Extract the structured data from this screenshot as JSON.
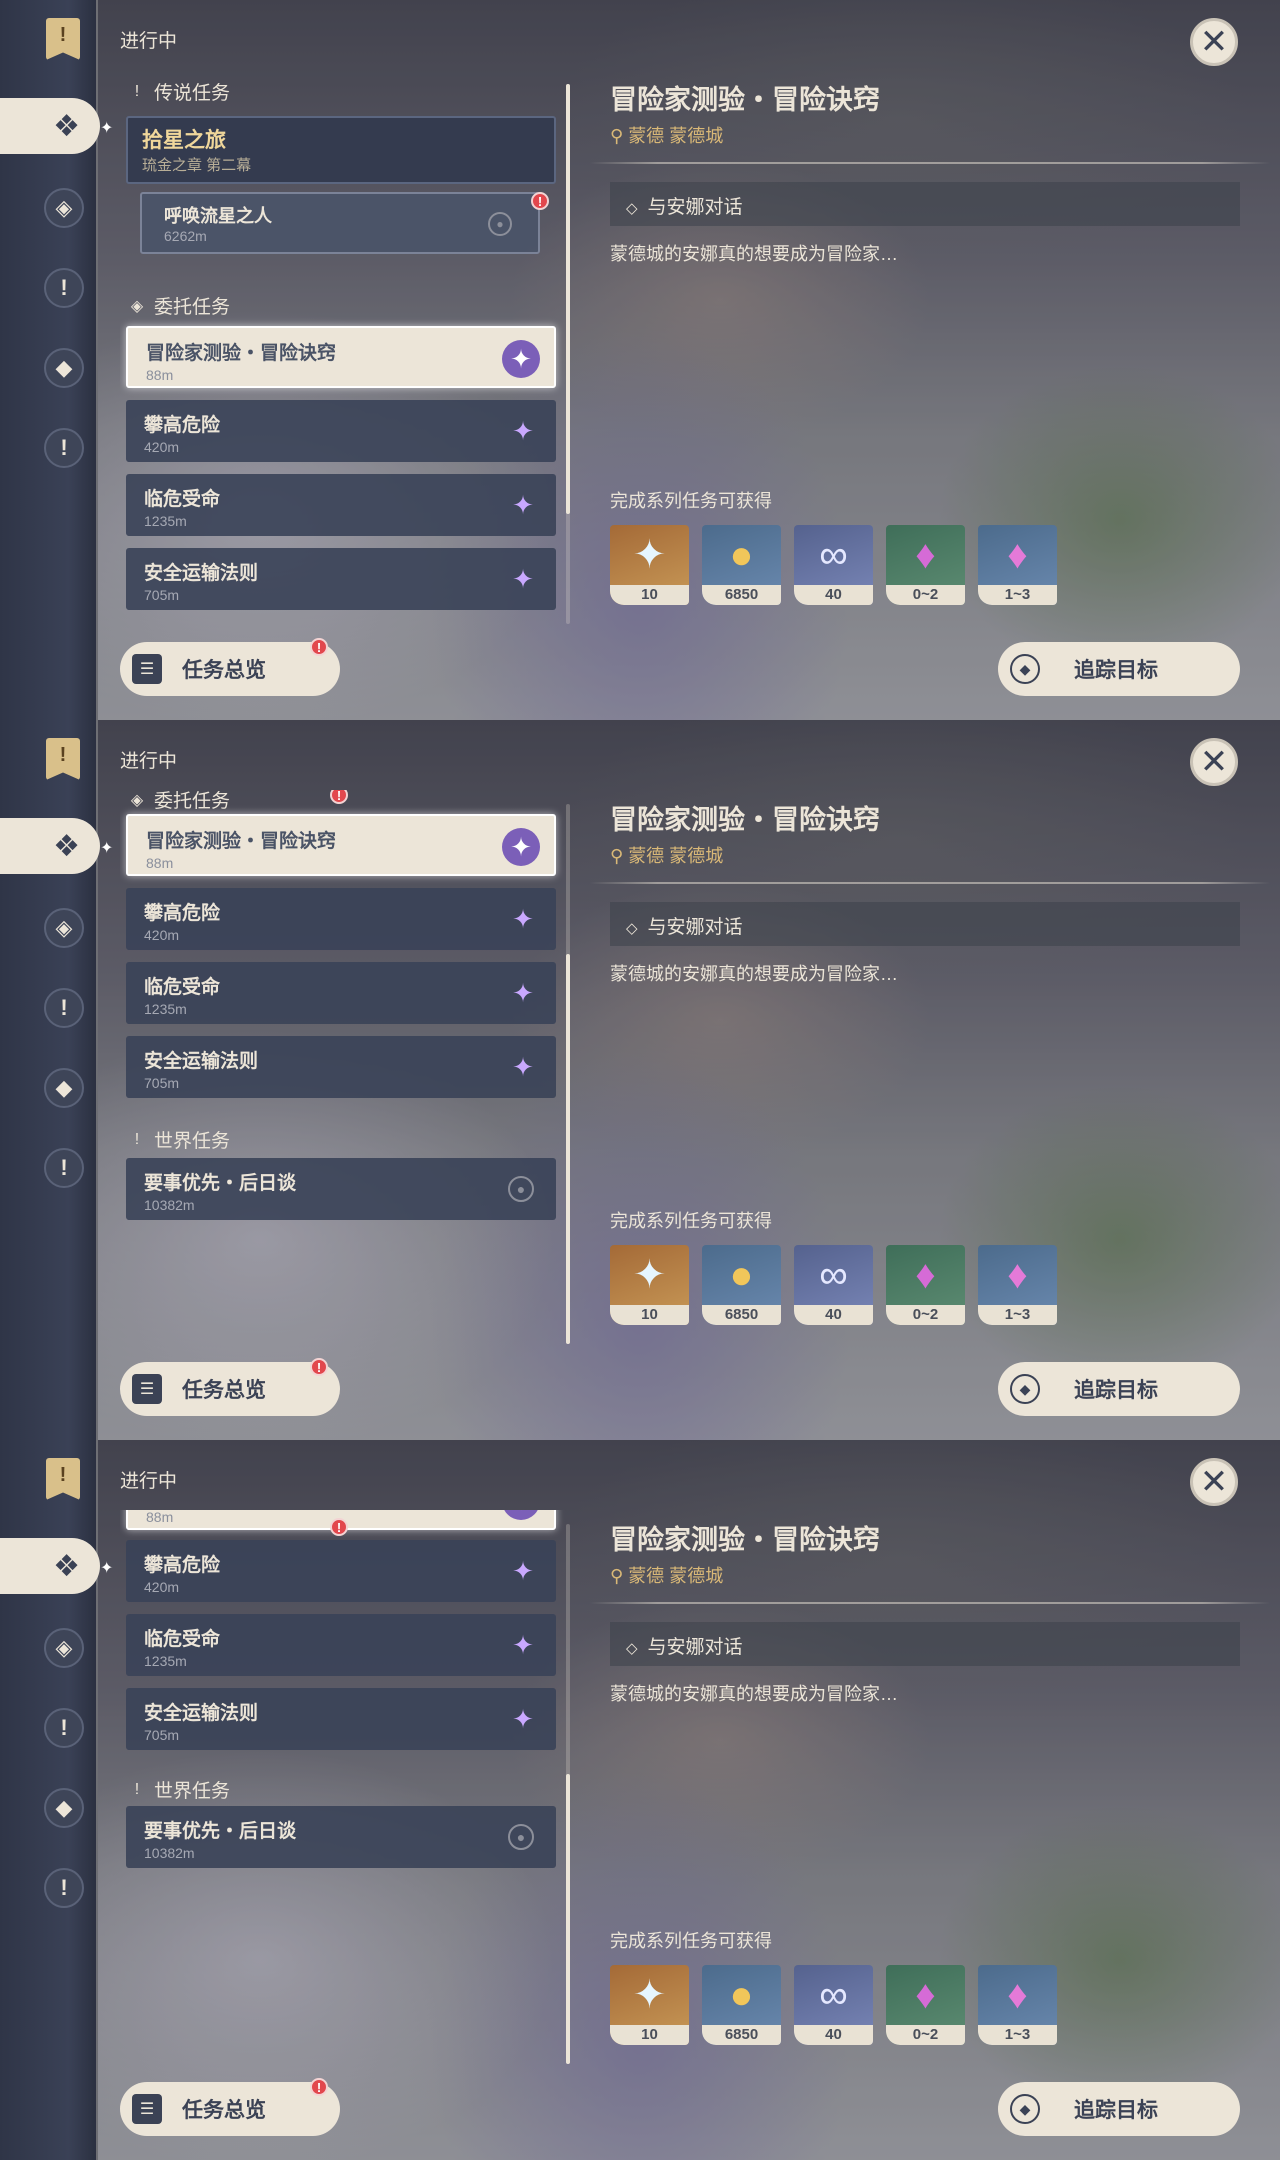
{
  "header": {
    "in_progress": "进行中",
    "close_glyph": "✕"
  },
  "sections": {
    "legend": "传说任务",
    "commission": "委托任务",
    "world": "世界任务"
  },
  "legend_quest": {
    "name": "拾星之旅",
    "sub": "琉金之章 第二幕"
  },
  "legend_sub": {
    "name": "呼唤流星之人",
    "dist": "6262m"
  },
  "commissions": [
    {
      "name": "冒险家测验・冒险诀窍",
      "dist": "88m"
    },
    {
      "name": "攀高危险",
      "dist": "420m"
    },
    {
      "name": "临危受命",
      "dist": "1235m"
    },
    {
      "name": "安全运输法则",
      "dist": "705m"
    }
  ],
  "world_quest": {
    "name": "要事优先・后日谈",
    "dist": "10382m"
  },
  "detail": {
    "title": "冒险家测验・冒险诀窍",
    "location": "蒙德 蒙德城",
    "objective": "与安娜对话",
    "description": "蒙德城的安娜真的想要成为冒险家…",
    "reward_label": "完成系列任务可获得",
    "rewards": [
      {
        "icon": "primogem-icon",
        "count": "10"
      },
      {
        "icon": "mora-icon",
        "count": "6850"
      },
      {
        "icon": "exp-icon",
        "count": "40"
      },
      {
        "icon": "crystal-chunk-icon",
        "count": "0~2"
      },
      {
        "icon": "crystal-cluster-icon",
        "count": "1~3"
      }
    ]
  },
  "buttons": {
    "overview": "任务总览",
    "track": "追踪目标"
  },
  "badge": "!",
  "colors": {
    "accent_cream": "#ece5d8",
    "legend_gold": "#f0d79b",
    "location_gold": "#d9b877",
    "badge_red": "#e2474d"
  }
}
